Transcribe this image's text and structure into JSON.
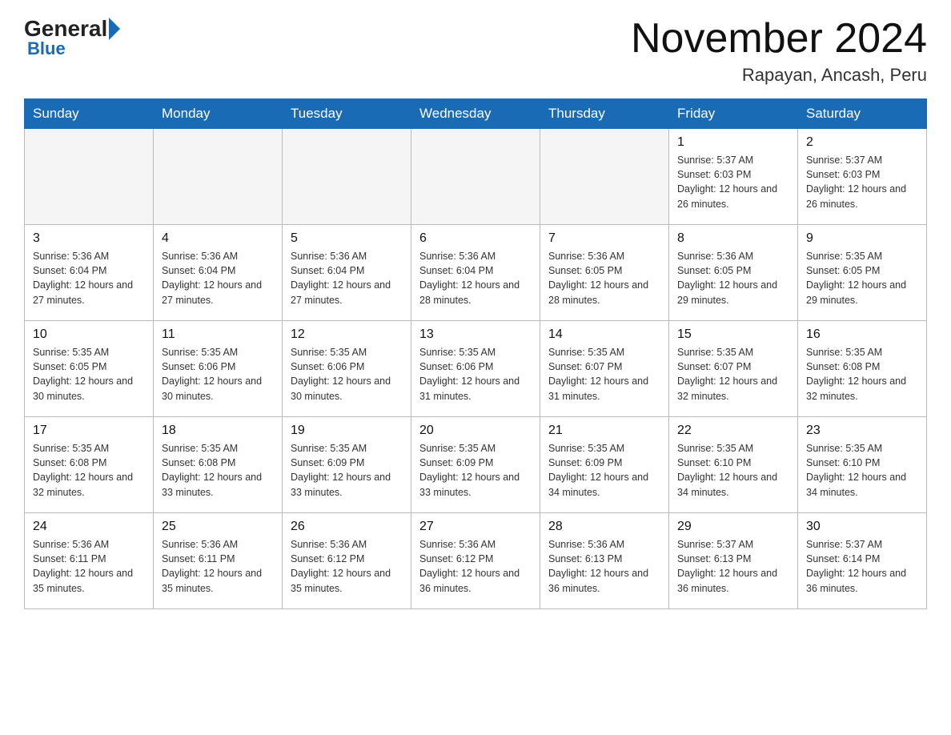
{
  "header": {
    "logo_general": "General",
    "logo_blue": "Blue",
    "month_title": "November 2024",
    "subtitle": "Rapayan, Ancash, Peru"
  },
  "calendar": {
    "days_of_week": [
      "Sunday",
      "Monday",
      "Tuesday",
      "Wednesday",
      "Thursday",
      "Friday",
      "Saturday"
    ],
    "weeks": [
      [
        {
          "day": "",
          "info": ""
        },
        {
          "day": "",
          "info": ""
        },
        {
          "day": "",
          "info": ""
        },
        {
          "day": "",
          "info": ""
        },
        {
          "day": "",
          "info": ""
        },
        {
          "day": "1",
          "info": "Sunrise: 5:37 AM\nSunset: 6:03 PM\nDaylight: 12 hours and 26 minutes."
        },
        {
          "day": "2",
          "info": "Sunrise: 5:37 AM\nSunset: 6:03 PM\nDaylight: 12 hours and 26 minutes."
        }
      ],
      [
        {
          "day": "3",
          "info": "Sunrise: 5:36 AM\nSunset: 6:04 PM\nDaylight: 12 hours and 27 minutes."
        },
        {
          "day": "4",
          "info": "Sunrise: 5:36 AM\nSunset: 6:04 PM\nDaylight: 12 hours and 27 minutes."
        },
        {
          "day": "5",
          "info": "Sunrise: 5:36 AM\nSunset: 6:04 PM\nDaylight: 12 hours and 27 minutes."
        },
        {
          "day": "6",
          "info": "Sunrise: 5:36 AM\nSunset: 6:04 PM\nDaylight: 12 hours and 28 minutes."
        },
        {
          "day": "7",
          "info": "Sunrise: 5:36 AM\nSunset: 6:05 PM\nDaylight: 12 hours and 28 minutes."
        },
        {
          "day": "8",
          "info": "Sunrise: 5:36 AM\nSunset: 6:05 PM\nDaylight: 12 hours and 29 minutes."
        },
        {
          "day": "9",
          "info": "Sunrise: 5:35 AM\nSunset: 6:05 PM\nDaylight: 12 hours and 29 minutes."
        }
      ],
      [
        {
          "day": "10",
          "info": "Sunrise: 5:35 AM\nSunset: 6:05 PM\nDaylight: 12 hours and 30 minutes."
        },
        {
          "day": "11",
          "info": "Sunrise: 5:35 AM\nSunset: 6:06 PM\nDaylight: 12 hours and 30 minutes."
        },
        {
          "day": "12",
          "info": "Sunrise: 5:35 AM\nSunset: 6:06 PM\nDaylight: 12 hours and 30 minutes."
        },
        {
          "day": "13",
          "info": "Sunrise: 5:35 AM\nSunset: 6:06 PM\nDaylight: 12 hours and 31 minutes."
        },
        {
          "day": "14",
          "info": "Sunrise: 5:35 AM\nSunset: 6:07 PM\nDaylight: 12 hours and 31 minutes."
        },
        {
          "day": "15",
          "info": "Sunrise: 5:35 AM\nSunset: 6:07 PM\nDaylight: 12 hours and 32 minutes."
        },
        {
          "day": "16",
          "info": "Sunrise: 5:35 AM\nSunset: 6:08 PM\nDaylight: 12 hours and 32 minutes."
        }
      ],
      [
        {
          "day": "17",
          "info": "Sunrise: 5:35 AM\nSunset: 6:08 PM\nDaylight: 12 hours and 32 minutes."
        },
        {
          "day": "18",
          "info": "Sunrise: 5:35 AM\nSunset: 6:08 PM\nDaylight: 12 hours and 33 minutes."
        },
        {
          "day": "19",
          "info": "Sunrise: 5:35 AM\nSunset: 6:09 PM\nDaylight: 12 hours and 33 minutes."
        },
        {
          "day": "20",
          "info": "Sunrise: 5:35 AM\nSunset: 6:09 PM\nDaylight: 12 hours and 33 minutes."
        },
        {
          "day": "21",
          "info": "Sunrise: 5:35 AM\nSunset: 6:09 PM\nDaylight: 12 hours and 34 minutes."
        },
        {
          "day": "22",
          "info": "Sunrise: 5:35 AM\nSunset: 6:10 PM\nDaylight: 12 hours and 34 minutes."
        },
        {
          "day": "23",
          "info": "Sunrise: 5:35 AM\nSunset: 6:10 PM\nDaylight: 12 hours and 34 minutes."
        }
      ],
      [
        {
          "day": "24",
          "info": "Sunrise: 5:36 AM\nSunset: 6:11 PM\nDaylight: 12 hours and 35 minutes."
        },
        {
          "day": "25",
          "info": "Sunrise: 5:36 AM\nSunset: 6:11 PM\nDaylight: 12 hours and 35 minutes."
        },
        {
          "day": "26",
          "info": "Sunrise: 5:36 AM\nSunset: 6:12 PM\nDaylight: 12 hours and 35 minutes."
        },
        {
          "day": "27",
          "info": "Sunrise: 5:36 AM\nSunset: 6:12 PM\nDaylight: 12 hours and 36 minutes."
        },
        {
          "day": "28",
          "info": "Sunrise: 5:36 AM\nSunset: 6:13 PM\nDaylight: 12 hours and 36 minutes."
        },
        {
          "day": "29",
          "info": "Sunrise: 5:37 AM\nSunset: 6:13 PM\nDaylight: 12 hours and 36 minutes."
        },
        {
          "day": "30",
          "info": "Sunrise: 5:37 AM\nSunset: 6:14 PM\nDaylight: 12 hours and 36 minutes."
        }
      ]
    ]
  }
}
